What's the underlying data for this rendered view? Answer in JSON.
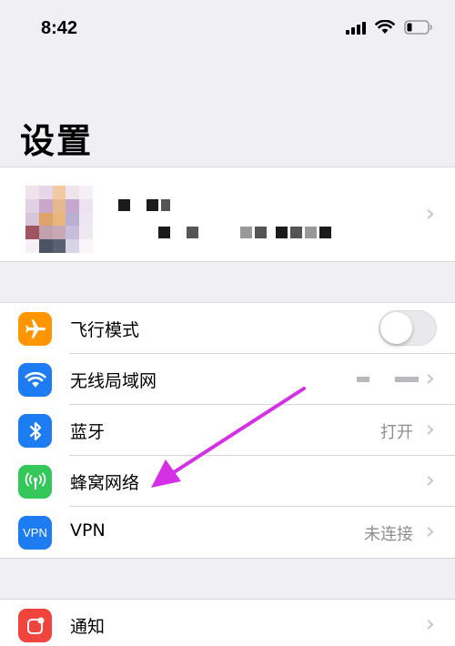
{
  "status_bar": {
    "time": "8:42",
    "icons": [
      "cellular-signal-icon",
      "wifi-icon",
      "battery-icon"
    ]
  },
  "page": {
    "title": "设置"
  },
  "profile": {
    "chevron": "›"
  },
  "group1": {
    "items": [
      {
        "label": "飞行模式",
        "icon": "airplane-icon",
        "color": "#ff9500",
        "control": "toggle",
        "toggle_on": false
      },
      {
        "label": "无线局域网",
        "icon": "wifi-icon",
        "color": "#1e7cf2",
        "value": "",
        "chevron": "›"
      },
      {
        "label": "蓝牙",
        "icon": "bluetooth-icon",
        "color": "#1e7cf2",
        "value": "打开",
        "chevron": "›"
      },
      {
        "label": "蜂窝网络",
        "icon": "antenna-icon",
        "color": "#34c759",
        "value": "",
        "chevron": "›"
      },
      {
        "label": "VPN",
        "icon": "vpn-icon",
        "icon_text": "VPN",
        "color": "#1e7cf2",
        "value": "未连接",
        "chevron": "›"
      }
    ]
  },
  "group2": {
    "items": [
      {
        "label": "通知",
        "icon": "notifications-icon",
        "color": "#f0443c",
        "chevron": "›"
      }
    ]
  },
  "annotation": {
    "arrow_color": "#d431e6"
  }
}
